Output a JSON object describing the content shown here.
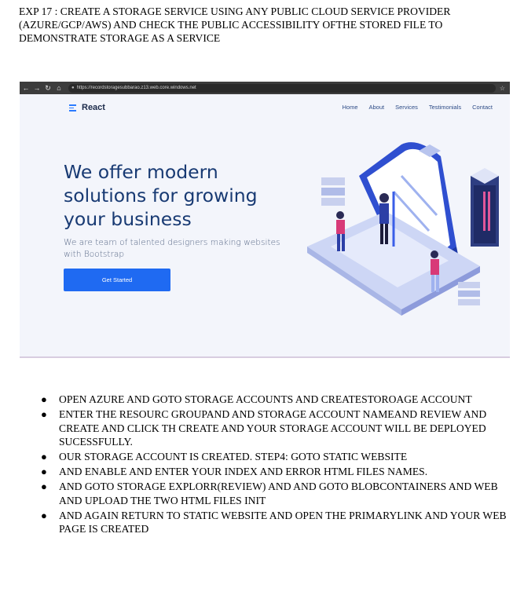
{
  "heading": "EXP 17 : CREATE A STORAGE SERVICE USING ANY PUBLIC CLOUD SERVICE PROVIDER (AZURE/GCP/AWS) AND CHECK THE PUBLIC ACCESSIBILITY OFTHE STORED FILE TO DEMONSTRATE STORAGE AS A SERVICE",
  "screenshot": {
    "browser": {
      "url": "https://recordstoragesubbarao.z13.web.core.windows.net"
    },
    "site": {
      "brand": "React",
      "menu": [
        "Home",
        "About",
        "Services",
        "Testimonials",
        "Contact"
      ],
      "hero_title": "We offer modern solutions for growing your business",
      "hero_subtitle": "We are team of talented designers making websites with Bootstrap",
      "cta_label": "Get Started"
    },
    "colors": {
      "accent": "#1f6af2",
      "title": "#183a73",
      "background": "#f3f5fb"
    }
  },
  "steps": [
    "OPEN AZURE AND GOTO STORAGE ACCOUNTS AND CREATESTOROAGE ACCOUNT",
    "ENTER THE RESOURC GROUPAND AND STORAGE ACCOUNT NAMEAND REVIEW AND CREATE AND CLICK TH CREATE AND YOUR STORAGE ACCOUNT WILL BE DEPLOYED SUCESSFULLY.",
    "OUR STORAGE ACCOUNT IS CREATED. STEP4: GOTO STATIC WEBSITE",
    "AND ENABLE AND ENTER YOUR INDEX AND ERROR HTML FILES NAMES.",
    "AND GOTO STORAGE EXPLORR(REVIEW) AND AND GOTO BLOBCONTAINERS AND WEB AND UPLOAD THE TWO HTML FILES INIT",
    "AND AGAIN RETURN TO STATIC WEBSITE AND OPEN THE PRIMARYLINK AND YOUR WEB PAGE IS CREATED"
  ]
}
